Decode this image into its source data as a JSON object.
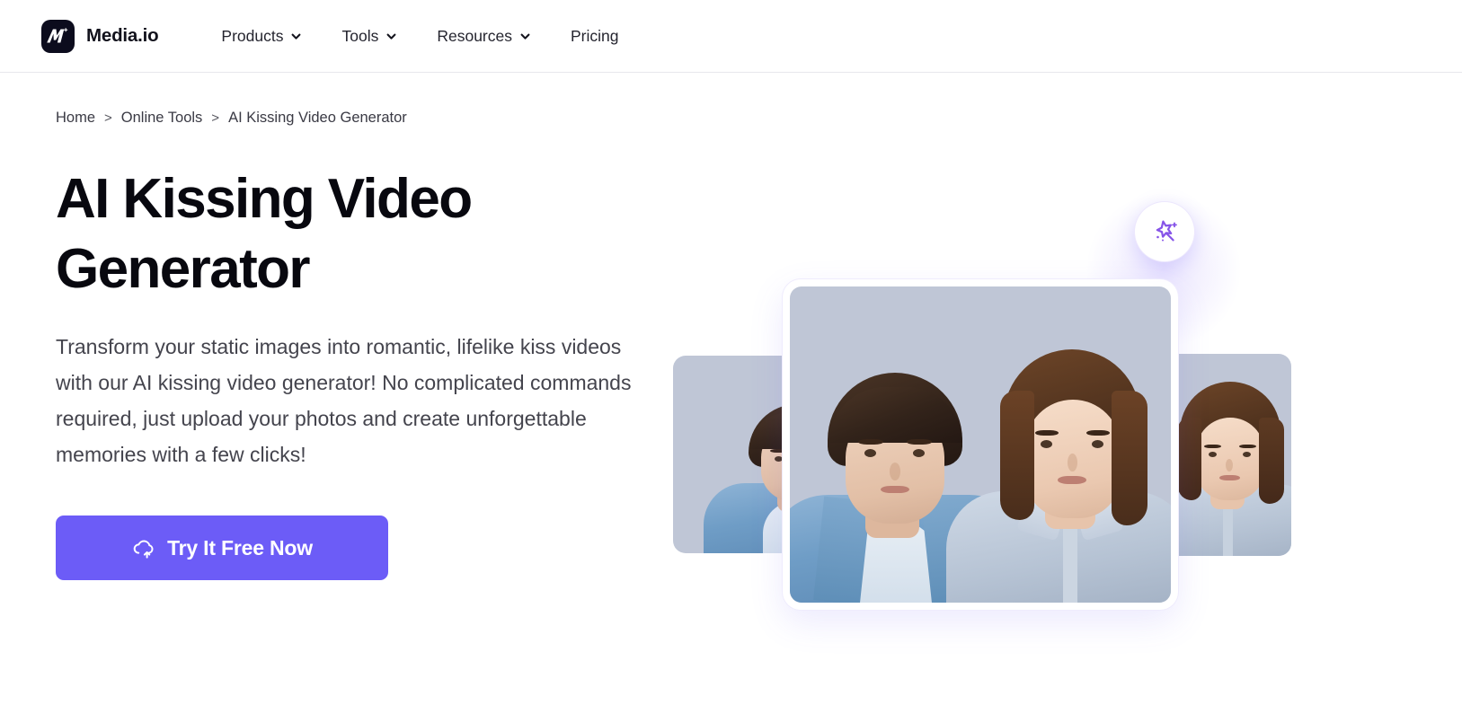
{
  "brand": {
    "name": "Media.io",
    "logo_icon": "media-io-logo-icon"
  },
  "nav": {
    "items": [
      {
        "label": "Products",
        "has_dropdown": true,
        "icon": "chevron-down-icon"
      },
      {
        "label": "Tools",
        "has_dropdown": true,
        "icon": "chevron-down-icon"
      },
      {
        "label": "Resources",
        "has_dropdown": true,
        "icon": "chevron-down-icon"
      },
      {
        "label": "Pricing",
        "has_dropdown": false,
        "icon": ""
      }
    ]
  },
  "breadcrumb": {
    "separator": ">",
    "items": [
      {
        "label": "Home",
        "current": false
      },
      {
        "label": "Online Tools",
        "current": false
      },
      {
        "label": "AI Kissing Video Generator",
        "current": true
      }
    ]
  },
  "hero": {
    "title": "AI Kissing Video Generator",
    "description": "Transform your static images into romantic, lifelike kiss videos with our AI kissing video generator! No complicated commands required, just upload your photos and create unforgettable memories with a few clicks!",
    "cta": {
      "label": "Try It Free Now",
      "icon": "cloud-upload-icon"
    }
  },
  "visual": {
    "magic_badge_icon": "magic-wand-sparkle-icon",
    "cards": [
      {
        "name": "side-card-left",
        "subject": "man-portrait"
      },
      {
        "name": "center-card",
        "subject": "man-and-woman-portrait"
      },
      {
        "name": "side-card-right",
        "subject": "woman-portrait"
      }
    ]
  },
  "colors": {
    "accent": "#6C5CF7",
    "text_primary": "#08080F",
    "text_secondary": "#44444D",
    "logo_bg": "#0C0C1D",
    "photo_bg": "#BFC6D6",
    "header_border": "#E8E8EC"
  }
}
